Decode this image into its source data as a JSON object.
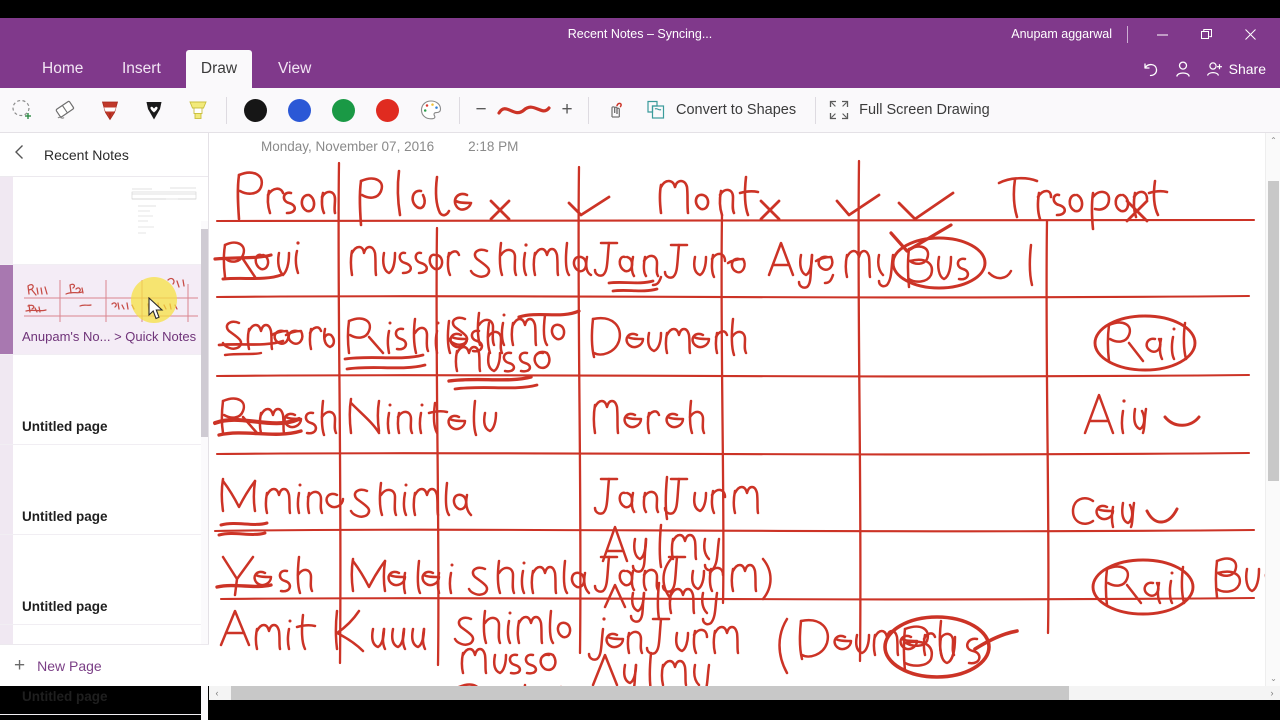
{
  "window": {
    "title": "Recent Notes – Syncing...",
    "user": "Anupam aggarwal",
    "minimize_label": "Minimize",
    "maximize_label": "Restore",
    "close_label": "Close"
  },
  "ribbon": {
    "tabs": [
      {
        "label": "Home",
        "active": false
      },
      {
        "label": "Insert",
        "active": false
      },
      {
        "label": "Draw",
        "active": true
      },
      {
        "label": "View",
        "active": false
      }
    ],
    "right_items": [
      {
        "name": "undo-button",
        "label": ""
      },
      {
        "name": "account-button",
        "label": ""
      },
      {
        "name": "share-button",
        "label": "Share"
      }
    ]
  },
  "toolbar": {
    "tools": [
      {
        "name": "lasso-select-icon",
        "label": "Lasso Select"
      },
      {
        "name": "eraser-icon",
        "label": "Eraser"
      },
      {
        "name": "red-pen-icon",
        "label": "Pen"
      },
      {
        "name": "black-pen-icon",
        "label": "Pencil"
      },
      {
        "name": "highlighter-icon",
        "label": "Highlighter"
      }
    ],
    "colors": [
      {
        "name": "color-black",
        "hex": "#161616"
      },
      {
        "name": "color-blue",
        "hex": "#2b58d6"
      },
      {
        "name": "color-green",
        "hex": "#1a9945"
      },
      {
        "name": "color-red",
        "hex": "#e02b20"
      }
    ],
    "more_colors_label": "More Colors",
    "thickness_decrease": "−",
    "thickness_increase": "+",
    "ink_to_text_label": "Ink to Text",
    "convert_to_shapes_label": "Convert to Shapes",
    "full_screen_drawing_label": "Full Screen Drawing"
  },
  "sidebar": {
    "header_title": "Recent Notes",
    "back_label": "Back",
    "new_page_label": "New Page",
    "items": [
      {
        "label": "",
        "breadcrumb": "",
        "selected": false
      },
      {
        "label": "Anupam's No... > Quick Notes",
        "selected": true
      },
      {
        "label": "Untitled page",
        "selected": false
      },
      {
        "label": "Untitled page",
        "selected": false
      },
      {
        "label": "Untitled page",
        "selected": false
      },
      {
        "label": "Untitled page",
        "selected": false
      }
    ]
  },
  "page": {
    "date": "Monday, November 07, 2016",
    "time": "2:18 PM",
    "ink_color": "#cc3326"
  },
  "handwriting": {
    "headers": [
      "Person",
      "Place",
      "Month",
      "Transport"
    ],
    "rows": [
      {
        "person": "Ravi",
        "place": [
          "mussoorie",
          "Shimla"
        ],
        "month": [
          "Jan, June",
          "Aug, May"
        ],
        "transport": [
          "Bus"
        ]
      },
      {
        "person": "Sameer",
        "place": [
          "Rishikesh",
          "Shimla  musso"
        ],
        "month": [
          "December"
        ],
        "transport": [
          "Rail"
        ]
      },
      {
        "person": "Ramesh",
        "place": [
          "Nainital"
        ],
        "month": [
          "March"
        ],
        "transport": [
          "Air"
        ]
      },
      {
        "person": "Manish",
        "place": [
          "Shimla"
        ],
        "month": [
          "Jan|June",
          "Aug | may"
        ],
        "transport": [
          "Car"
        ]
      },
      {
        "person": "Yash",
        "place": [
          "Manali",
          "Shimla"
        ],
        "month": [
          "Jan (June)",
          "Aug | may"
        ],
        "transport": [
          "Rail",
          "Bus, air"
        ]
      },
      {
        "person": "Amit",
        "place": [
          "Kullu",
          "shimla musso Rishikesh"
        ],
        "month": [
          "jan June Aug|may",
          "(December"
        ],
        "transport": [
          "Bus"
        ]
      }
    ]
  }
}
